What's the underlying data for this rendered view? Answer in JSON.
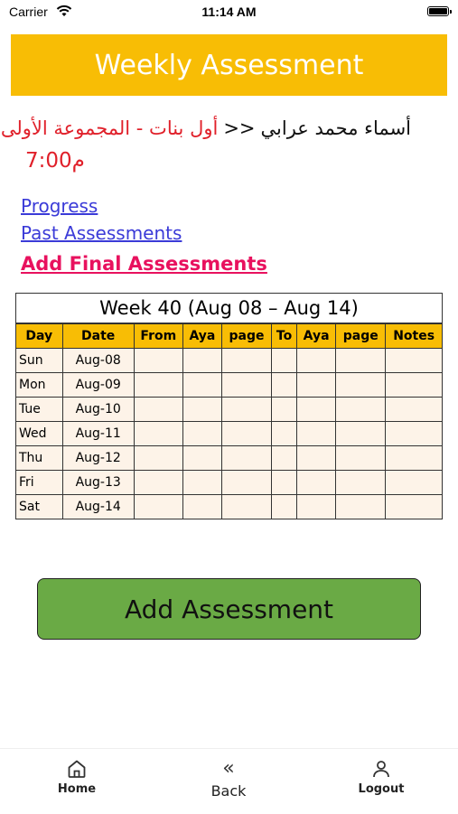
{
  "status_bar": {
    "carrier": "Carrier",
    "time": "11:14 AM"
  },
  "header": {
    "title": "Weekly Assessment"
  },
  "student": {
    "name": "أسماء محمد عرابي",
    "separator": "<<",
    "group": "أول بنات - المجموعة الأولى",
    "time": "7:00م"
  },
  "links": {
    "progress": "Progress",
    "past": "Past Assessments",
    "final": "Add Final Assessments"
  },
  "table": {
    "week_title": "Week 40 (Aug 08 – Aug 14)",
    "headers": [
      "Day",
      "Date",
      "From",
      "Aya",
      "page",
      "To",
      "Aya",
      "page",
      "Notes"
    ],
    "rows": [
      {
        "day": "Sun",
        "date": "Aug-08"
      },
      {
        "day": "Mon",
        "date": "Aug-09"
      },
      {
        "day": "Tue",
        "date": "Aug-10"
      },
      {
        "day": "Wed",
        "date": "Aug-11"
      },
      {
        "day": "Thu",
        "date": "Aug-12"
      },
      {
        "day": "Fri",
        "date": "Aug-13"
      },
      {
        "day": "Sat",
        "date": "Aug-14"
      }
    ]
  },
  "add_button": {
    "label": "Add Assessment"
  },
  "nav": {
    "home": "Home",
    "back": "Back",
    "logout": "Logout",
    "back_glyph": "«"
  },
  "colors": {
    "header_bg": "#f8bd05",
    "table_cell_bg": "#fdf3e8",
    "button_bg": "#6aaa45",
    "link": "#3b3bd8",
    "final_link": "#e8115e",
    "group_text": "#e0202a"
  }
}
